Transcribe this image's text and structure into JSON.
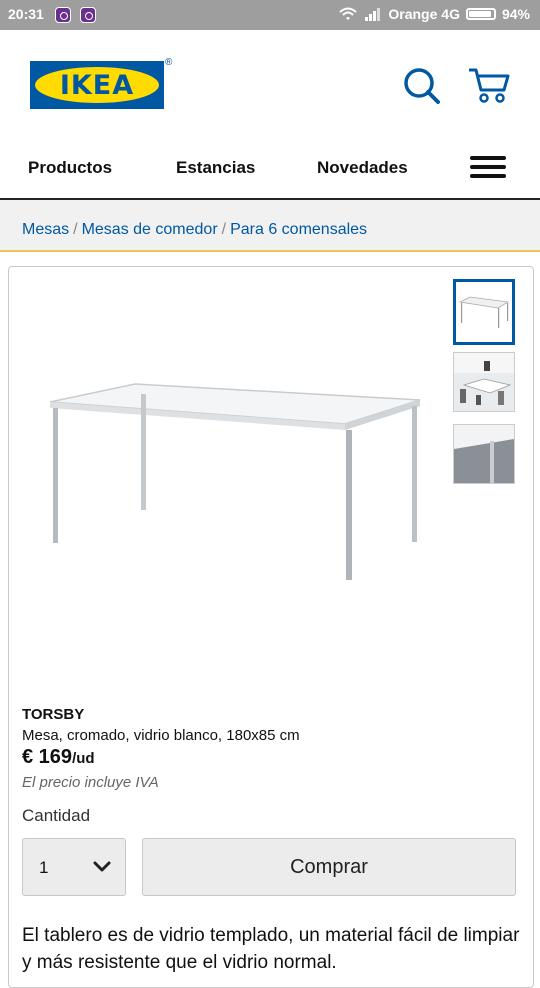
{
  "status_bar": {
    "time": "20:31",
    "carrier": "Orange 4G",
    "battery_percent": "94%",
    "battery_level": 0.94
  },
  "header": {
    "logo_text": "IKEA",
    "logo_reg": "®",
    "icons": {
      "search": "search-icon",
      "cart": "cart-icon"
    }
  },
  "nav": {
    "items": [
      "Productos",
      "Estancias",
      "Novedades"
    ],
    "menu_icon": "hamburger-menu-icon"
  },
  "breadcrumb": {
    "items": [
      "Mesas",
      "Mesas de comedor",
      "Para 6 comensales"
    ],
    "separator": "/"
  },
  "product": {
    "name": "TORSBY",
    "description": "Mesa, cromado, vidrio blanco, 180x85 cm",
    "price": "€ 169",
    "price_unit": "/ud",
    "vat_note": "El precio incluye IVA",
    "quantity_label": "Cantidad",
    "quantity_value": "1",
    "buy_label": "Comprar",
    "body_text": "El tablero es de vidrio templado, un material fácil de limpiar y más resistente que el vidrio normal."
  },
  "colors": {
    "brand_blue": "#0058a3",
    "brand_yellow": "#ffdb00",
    "status_bar": "#9e9e9e",
    "breadcrumb_border": "#f0c35a"
  }
}
